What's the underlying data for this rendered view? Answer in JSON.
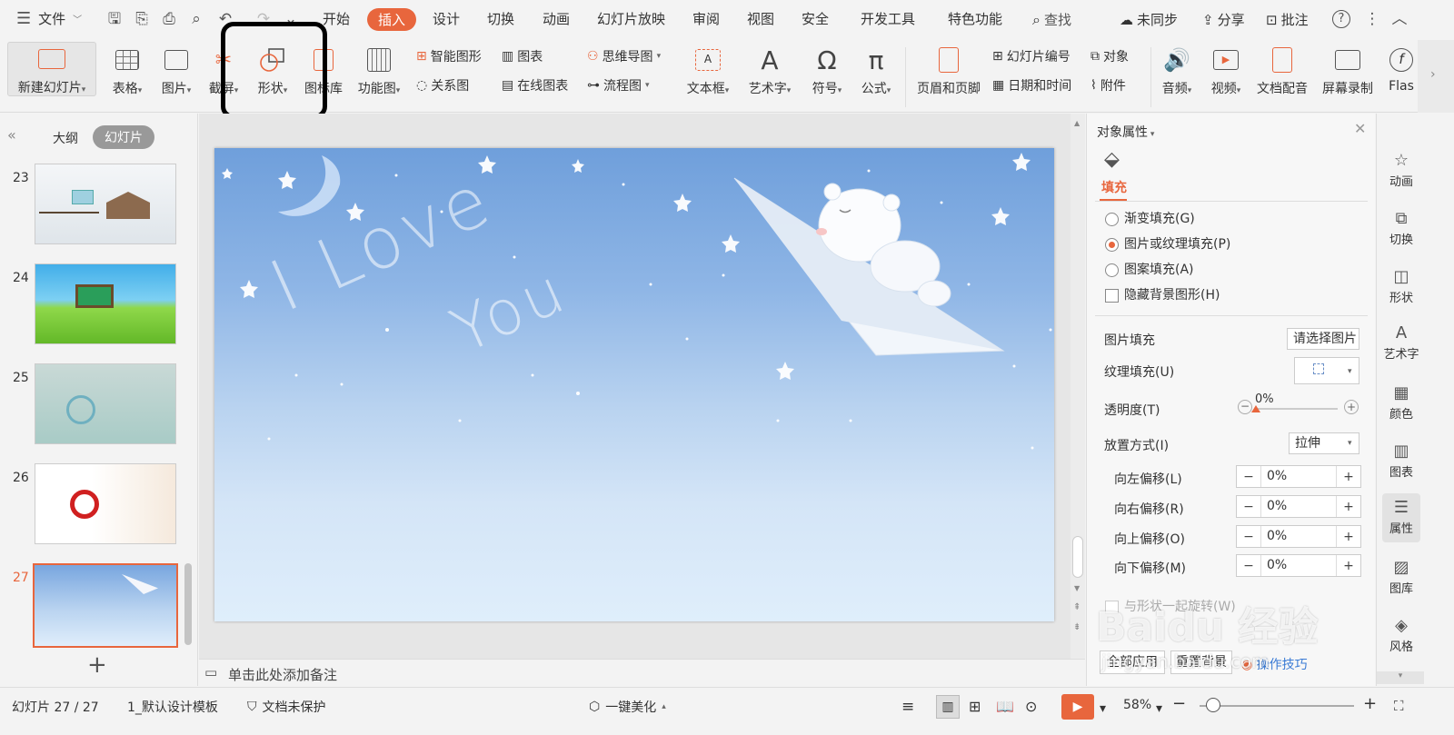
{
  "menubar": {
    "file_label": "文件",
    "tabs": [
      "开始",
      "插入",
      "设计",
      "切换",
      "动画",
      "幻灯片放映",
      "审阅",
      "视图",
      "安全",
      "开发工具",
      "特色功能"
    ],
    "active_tab": "插入",
    "search_label": "查找",
    "sync_label": "未同步",
    "share_label": "分享",
    "comment_label": "批注"
  },
  "ribbon": {
    "new_slide": "新建幻灯片",
    "table": "表格",
    "picture": "图片",
    "screenshot": "截屏",
    "shape": "形状",
    "icon_lib": "图标库",
    "func_chart": "功能图",
    "smart_art": "智能图形",
    "chart": "图表",
    "relation": "关系图",
    "online_chart": "在线图表",
    "mindmap": "思维导图",
    "flowchart": "流程图",
    "textbox": "文本框",
    "wordart": "艺术字",
    "symbol": "符号",
    "formula": "公式",
    "header_footer": "页眉和页脚",
    "slide_number": "幻灯片编号",
    "object": "对象",
    "date_time": "日期和时间",
    "attachment": "附件",
    "audio": "音频",
    "video": "视频",
    "doc_voice": "文档配音",
    "screen_record": "屏幕录制",
    "flash": "Flas"
  },
  "left_panel": {
    "tab_outline": "大纲",
    "tab_slides": "幻灯片",
    "slides": [
      {
        "num": "23"
      },
      {
        "num": "24"
      },
      {
        "num": "25"
      },
      {
        "num": "26"
      },
      {
        "num": "27"
      }
    ],
    "add_label": "+"
  },
  "slide": {
    "text_line1": "I Love",
    "text_line2": "You"
  },
  "notes": {
    "placeholder": "单击此处添加备注"
  },
  "right_panel": {
    "title": "对象属性",
    "tab_fill": "填充",
    "fill_options": [
      {
        "label": "渐变填充(G)",
        "selected": false
      },
      {
        "label": "图片或纹理填充(P)",
        "selected": true
      },
      {
        "label": "图案填充(A)",
        "selected": false
      }
    ],
    "hide_bg_label": "隐藏背景图形(H)",
    "picture_fill_label": "图片填充",
    "picture_fill_value": "请选择图片",
    "texture_fill_label": "纹理填充(U)",
    "transparency_label": "透明度(T)",
    "transparency_value": "0%",
    "transparency": 0,
    "placement_label": "放置方式(I)",
    "placement_value": "拉伸",
    "offsets": [
      {
        "label": "向左偏移(L)",
        "value": "0%"
      },
      {
        "label": "向右偏移(R)",
        "value": "0%"
      },
      {
        "label": "向上偏移(O)",
        "value": "0%"
      },
      {
        "label": "向下偏移(M)",
        "value": "0%"
      }
    ],
    "rotate_with_shape": "与形状一起旋转(W)",
    "apply_all": "全部应用",
    "reset_bg": "重置背景",
    "tips": "操作技巧"
  },
  "side_tabs": [
    {
      "label": "动画",
      "icon": "star-icon"
    },
    {
      "label": "切换",
      "icon": "transition-icon"
    },
    {
      "label": "形状",
      "icon": "shape-icon"
    },
    {
      "label": "艺术字",
      "icon": "wordart-icon"
    },
    {
      "label": "颜色",
      "icon": "color-icon"
    },
    {
      "label": "图表",
      "icon": "chart-icon"
    },
    {
      "label": "属性",
      "icon": "property-icon"
    },
    {
      "label": "图库",
      "icon": "gallery-icon"
    },
    {
      "label": "风格",
      "icon": "style-icon"
    }
  ],
  "status": {
    "slide_info": "幻灯片 27 / 27",
    "template": "1_默认设计模板",
    "protect": "文档未保护",
    "beautify": "一键美化",
    "zoom": "58%",
    "zoom_level": 0.58
  },
  "watermark": {
    "brand": "Baidu 经验",
    "url": "jingyan.baidu.com"
  },
  "colors": {
    "accent": "#e8663d",
    "highlight_box": "#000000"
  }
}
